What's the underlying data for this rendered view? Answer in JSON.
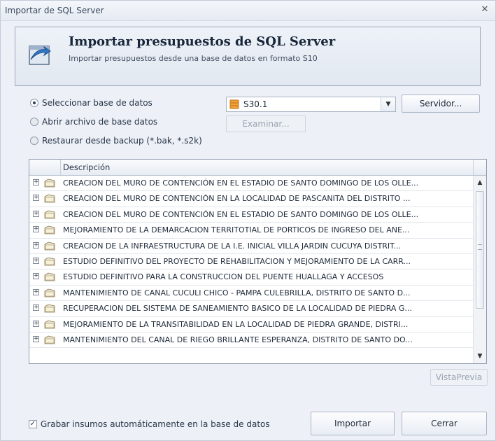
{
  "window": {
    "title": "Importar de SQL Server",
    "close_glyph": "✕"
  },
  "header": {
    "title": "Importar presupuestos de SQL Server",
    "description": "Importar presupuestos desde una base de datos en formato S10",
    "icon": "import-document-icon"
  },
  "source_options": {
    "select_db": {
      "label": "Seleccionar base de datos",
      "checked": true
    },
    "open_file": {
      "label": "Abrir archivo de base datos",
      "checked": false
    },
    "restore_backup": {
      "label": "Restaurar desde backup (*.bak, *.s2k)",
      "checked": false
    }
  },
  "database_select": {
    "value": "S30.1",
    "icon": "database-icon"
  },
  "buttons": {
    "server": "Servidor...",
    "browse": "Examinar...",
    "preview": "VistaPrevia",
    "import": "Importar",
    "close": "Cerrar"
  },
  "grid": {
    "column_description": "Descripción",
    "rows": [
      "CREACION DEL MURO DE CONTENCIÓN EN EL ESTADIO DE SANTO DOMINGO DE LOS OLLE...",
      "CREACION DEL MURO DE CONTENCIÓN EN LA LOCALIDAD DE PASCANITA DEL DISTRITO ...",
      "CREACION DEL MURO DE CONTENCIÓN EN EL ESTADIO DE SANTO DOMINGO DE LOS OLLE...",
      "MEJORAMIENTO DE LA DEMARCACION TERRITOTIAL DE PORTICOS DE INGRESO DEL ANE...",
      "CREACION DE LA INFRAESTRUCTURA DE LA I.E. INICIAL VILLA JARDIN CUCUYA DISTRIT...",
      "ESTUDIO DEFINITIVO DEL PROYECTO DE REHABILITACION Y MEJORAMIENTO DE LA CARR...",
      "ESTUDIO DEFINITIVO PARA LA CONSTRUCCION DEL PUENTE HUALLAGA Y ACCESOS",
      "MANTENIMIENTO DE CANAL CUCULI CHICO - PAMPA CULEBRILLA, DISTRITO DE SANTO D...",
      "RECUPERACION DEL SISTEMA DE SANEAMIENTO BASICO DE LA LOCALIDAD DE PIEDRA G...",
      "MEJORAMIENTO DE LA TRANSITABILIDAD EN LA LOCALIDAD DE PIEDRA GRANDE, DISTRI...",
      "MANTENIMIENTO DEL CANAL DE RIEGO BRILLANTE ESPERANZA, DISTRITO DE SANTO DO..."
    ]
  },
  "auto_save": {
    "label": "Grabar insumos automáticamente en la base de datos",
    "checked": true
  }
}
